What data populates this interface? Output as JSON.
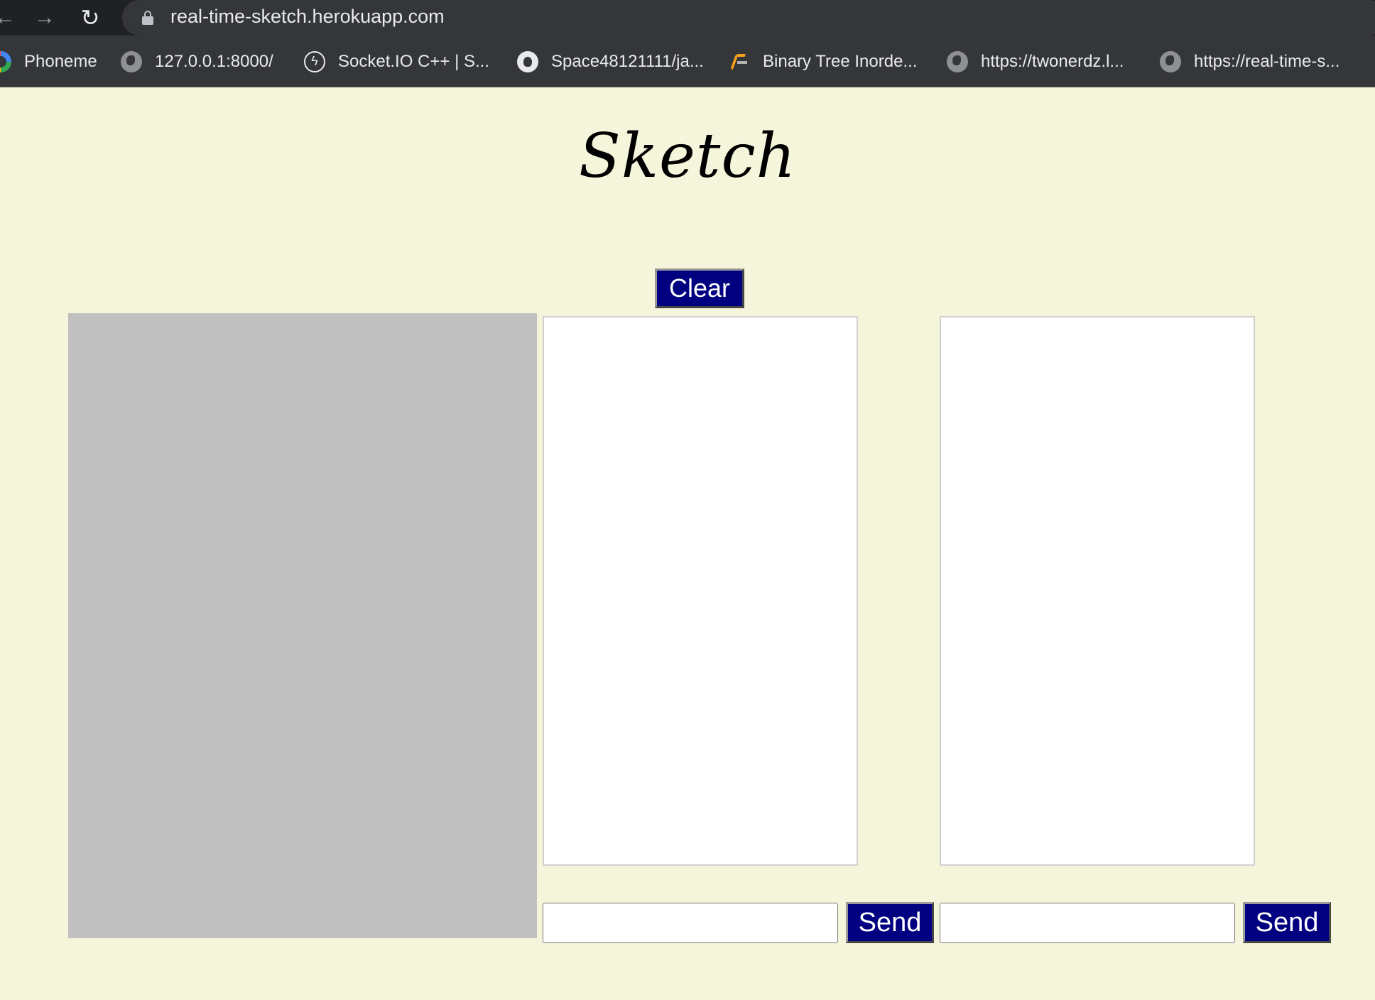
{
  "browser": {
    "url": "real-time-sketch.herokuapp.com",
    "nav": {
      "back": "←",
      "forward": "→",
      "reload": "↻"
    },
    "bookmarks": [
      {
        "label": "Phoneme",
        "icon": "google-icon"
      },
      {
        "label": "127.0.0.1:8000/",
        "icon": "globe-icon"
      },
      {
        "label": "Socket.IO C++ | S...",
        "icon": "socketio-icon"
      },
      {
        "label": "Space48121111/ja...",
        "icon": "github-icon"
      },
      {
        "label": "Binary Tree Inorde...",
        "icon": "leetcode-icon"
      },
      {
        "label": "https://twonerdz.l...",
        "icon": "globe-icon"
      },
      {
        "label": "https://real-time-s...",
        "icon": "globe-icon"
      }
    ]
  },
  "page": {
    "title": "Sketch",
    "clear_label": "Clear",
    "chat": [
      {
        "input_value": "",
        "send_label": "Send"
      },
      {
        "input_value": "",
        "send_label": "Send"
      }
    ]
  },
  "colors": {
    "page_background": "#f5f5dc",
    "button_background": "#000080",
    "canvas_background": "#c0c0c0"
  }
}
